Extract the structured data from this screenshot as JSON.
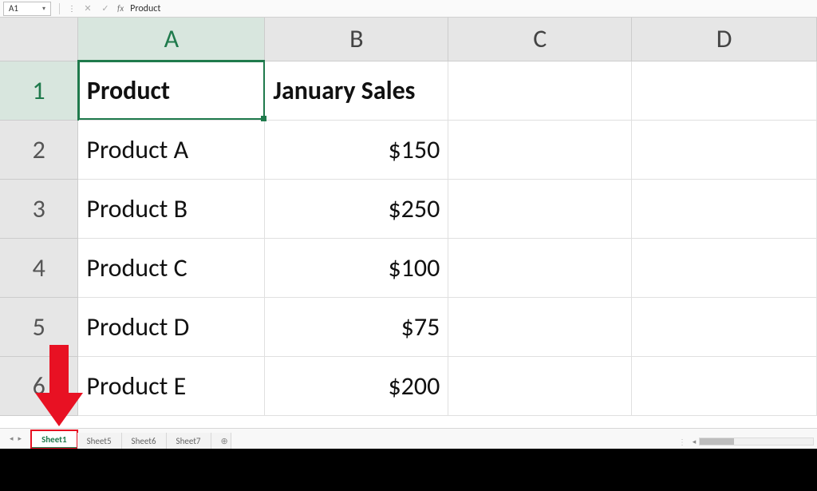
{
  "formula_bar": {
    "name_box": "A1",
    "cancel_glyph": "✕",
    "confirm_glyph": "✓",
    "fx_label": "fx",
    "value": "Product"
  },
  "columns": [
    "A",
    "B",
    "C",
    "D"
  ],
  "rows": [
    "1",
    "2",
    "3",
    "4",
    "5",
    "6"
  ],
  "cells": {
    "A1": "Product",
    "B1": "January Sales",
    "A2": "Product A",
    "B2": "$150",
    "A3": "Product B",
    "B3": "$250",
    "A4": "Product C",
    "B4": "$100",
    "A5": "Product D",
    "B5": "$75",
    "A6": "Product E",
    "B6": "$200"
  },
  "selection": {
    "cell": "A1",
    "row": "1",
    "col": "A"
  },
  "tabs": {
    "items": [
      "Sheet1",
      "Sheet5",
      "Sheet6",
      "Sheet7"
    ],
    "active": "Sheet1",
    "add_glyph": "⊕",
    "nav_left": "◂",
    "nav_right": "▸"
  },
  "hscroll": {
    "sep": "⋮",
    "left": "◂"
  }
}
